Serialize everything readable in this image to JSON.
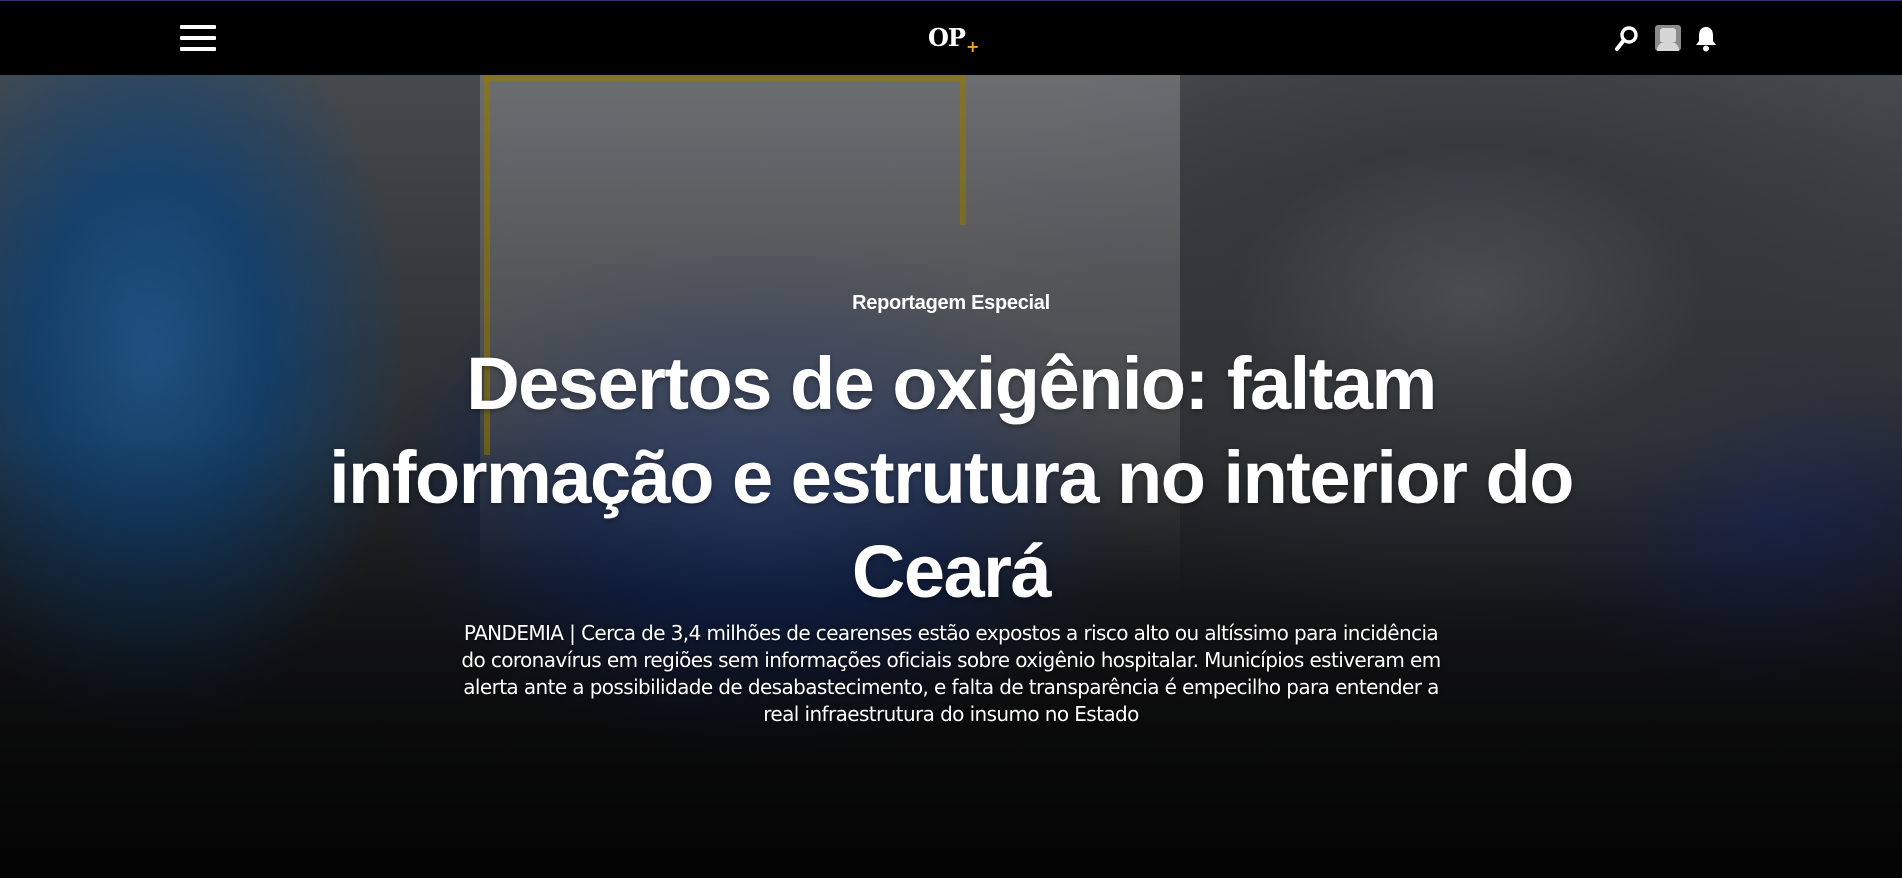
{
  "header": {
    "menu_icon": "hamburger-menu-icon",
    "logo_text": "OP",
    "logo_accent": "+",
    "logo_accent_color": "#f5a623",
    "search_icon": "search-icon",
    "avatar_icon": "user-avatar-icon",
    "bell_icon": "notification-bell-icon"
  },
  "hero": {
    "kicker": "Reportagem Especial",
    "headline": "Desertos de oxigênio: faltam informação e estrutura no interior do Ceará",
    "section": "PANDEMIA",
    "separator": "|",
    "summary": "Cerca de 3,4 milhões de cearenses estão expostos a risco alto ou altíssimo para incidência do coronavírus em regiões sem informações oficiais sobre oxigênio hospitalar. Municípios estiveram em alerta ante a possibilidade de desabastecimento, e falta de transparência é empecilho para entender a real infraestrutura do insumo no Estado"
  }
}
